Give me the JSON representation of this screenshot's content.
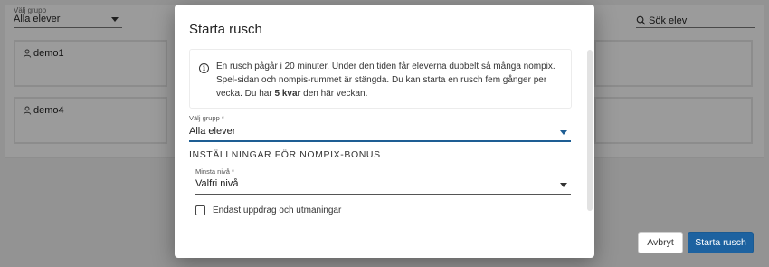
{
  "background": {
    "group_select": {
      "label": "Välj grupp",
      "value": "Alla elever"
    },
    "search": {
      "placeholder": "Sök elev"
    },
    "students": [
      {
        "name": "demo1"
      },
      {
        "name": "demo4"
      }
    ]
  },
  "dialog": {
    "title": "Starta rusch",
    "info": {
      "text_before": "En rusch pågår i 20 minuter. Under den tiden får eleverna dubbelt så många nompix. Spel-sidan och nompis-rummet är stängda. Du kan starta en rusch fem gånger per vecka. Du har ",
      "remaining": "5 kvar",
      "text_after": " den här veckan."
    },
    "group_field": {
      "label": "Välj grupp *",
      "value": "Alla elever"
    },
    "section_heading": "INSTÄLLNINGAR FÖR NOMPIX-BONUS",
    "level_field": {
      "label": "Minsta nivå *",
      "value": "Valfri nivå"
    },
    "checkbox": {
      "label": "Endast uppdrag och utmaningar",
      "checked": false
    },
    "buttons": {
      "cancel": "Avbryt",
      "start": "Starta rusch"
    }
  },
  "colors": {
    "primary": "#1d62a0",
    "overlay": "rgba(0,0,0,0.38)"
  }
}
